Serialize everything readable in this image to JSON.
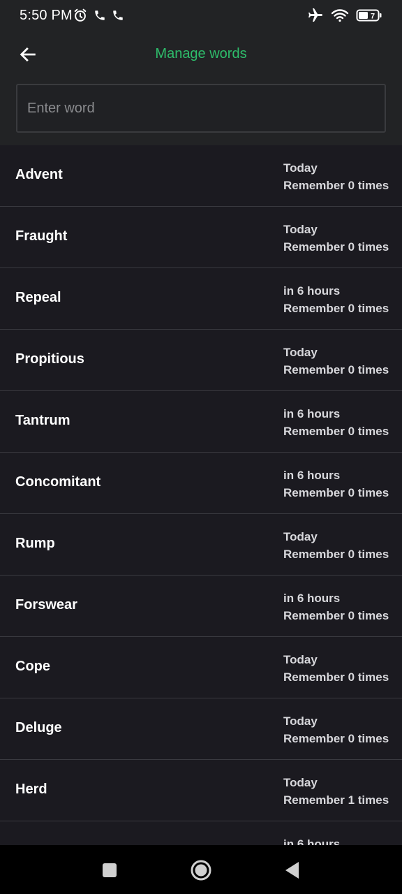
{
  "status_bar": {
    "time": "5:50 PM",
    "left_icons": [
      "alarm-icon",
      "phone-icon",
      "phone-icon"
    ],
    "right_icons": [
      "airplane-mode-icon",
      "wifi-icon",
      "battery-icon"
    ],
    "battery_level": "7"
  },
  "app_bar": {
    "title": "Manage words",
    "back_icon": "arrow-left-icon",
    "accent_color": "#2ebd6b"
  },
  "search": {
    "placeholder": "Enter word",
    "value": ""
  },
  "words": [
    {
      "word": "Advent",
      "due": "Today",
      "remember": "Remember 0 times"
    },
    {
      "word": "Fraught",
      "due": "Today",
      "remember": "Remember 0 times"
    },
    {
      "word": "Repeal",
      "due": "in 6 hours",
      "remember": "Remember 0 times"
    },
    {
      "word": "Propitious",
      "due": "Today",
      "remember": "Remember 0 times"
    },
    {
      "word": "Tantrum",
      "due": "in 6 hours",
      "remember": "Remember 0 times"
    },
    {
      "word": "Concomitant",
      "due": "in 6 hours",
      "remember": "Remember 0 times"
    },
    {
      "word": "Rump",
      "due": "Today",
      "remember": "Remember 0 times"
    },
    {
      "word": "Forswear",
      "due": "in 6 hours",
      "remember": "Remember 0 times"
    },
    {
      "word": "Cope",
      "due": "Today",
      "remember": "Remember 0 times"
    },
    {
      "word": "Deluge",
      "due": "Today",
      "remember": "Remember 0 times"
    },
    {
      "word": "Herd",
      "due": "Today",
      "remember": "Remember 1 times"
    },
    {
      "word": "",
      "due": "in 6 hours",
      "remember": ""
    }
  ],
  "nav_bar": {
    "buttons": [
      "recents-square-icon",
      "home-circle-icon",
      "back-triangle-icon"
    ]
  }
}
